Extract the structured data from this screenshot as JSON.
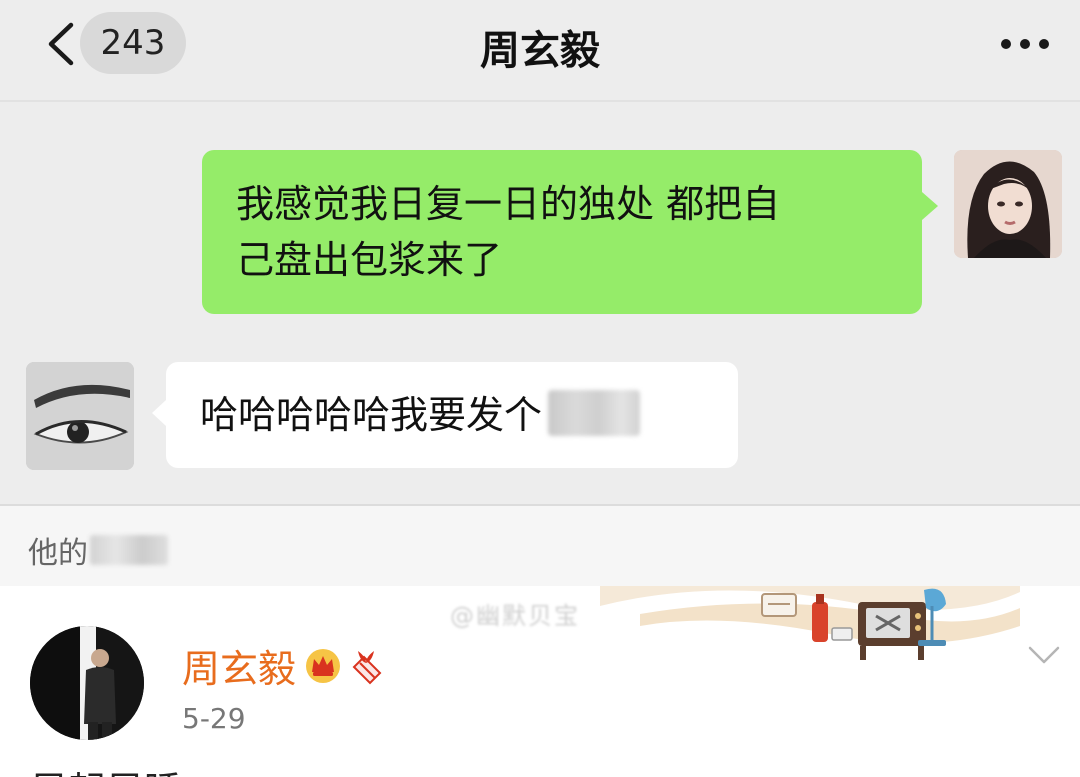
{
  "nav": {
    "unread_count": "243",
    "title": "周玄毅",
    "back_icon": "chevron-left-icon",
    "more_icon": "more-dots-icon"
  },
  "chat": {
    "messages": [
      {
        "side": "right",
        "text_line1": "我感觉我日复一日的独处 都把自",
        "text_line2": "己盘出包浆来了",
        "bubble_color": "#95ec69"
      },
      {
        "side": "left",
        "text": "哈哈哈哈哈我要发个",
        "blurred": true
      }
    ]
  },
  "caption": {
    "text": "他的"
  },
  "post": {
    "author": "周玄毅",
    "date": "5-29",
    "watermark_text": "@幽默贝宝",
    "body_cut": "早起早睡"
  },
  "colors": {
    "green_bubble": "#95ec69",
    "author_name": "#e86c1d",
    "background": "#ededed"
  }
}
